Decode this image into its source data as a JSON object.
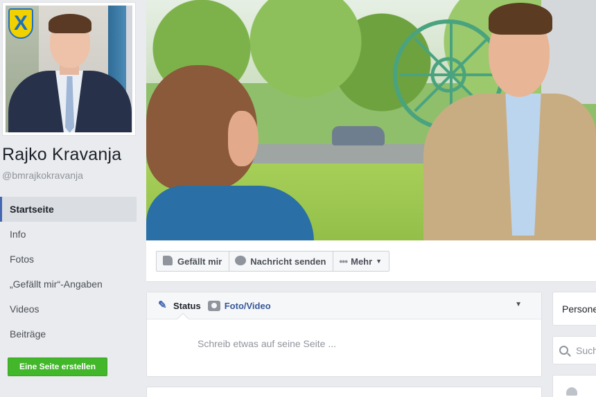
{
  "page": {
    "name": "Rajko Kravanja",
    "handle": "@bmrajkokravanja"
  },
  "left_nav": {
    "items": [
      {
        "label": "Startseite",
        "active": true
      },
      {
        "label": "Info",
        "active": false
      },
      {
        "label": "Fotos",
        "active": false
      },
      {
        "label": "„Gefällt mir“-Angaben",
        "active": false
      },
      {
        "label": "Videos",
        "active": false
      },
      {
        "label": "Beiträge",
        "active": false
      }
    ],
    "create_page_label": "Eine Seite erstellen"
  },
  "action_bar": {
    "like_label": "Gefällt mir",
    "message_label": "Nachricht senden",
    "more_label": "Mehr"
  },
  "composer": {
    "status_label": "Status",
    "photo_video_label": "Foto/Video",
    "placeholder": "Schreib etwas auf seine Seite ..."
  },
  "right_column": {
    "people_label": "Personen",
    "search_placeholder": "Suche"
  },
  "colors": {
    "background": "#e9ebee",
    "accent_blue": "#4267b2",
    "link_blue": "#365899",
    "create_button_green": "#42b72a"
  }
}
